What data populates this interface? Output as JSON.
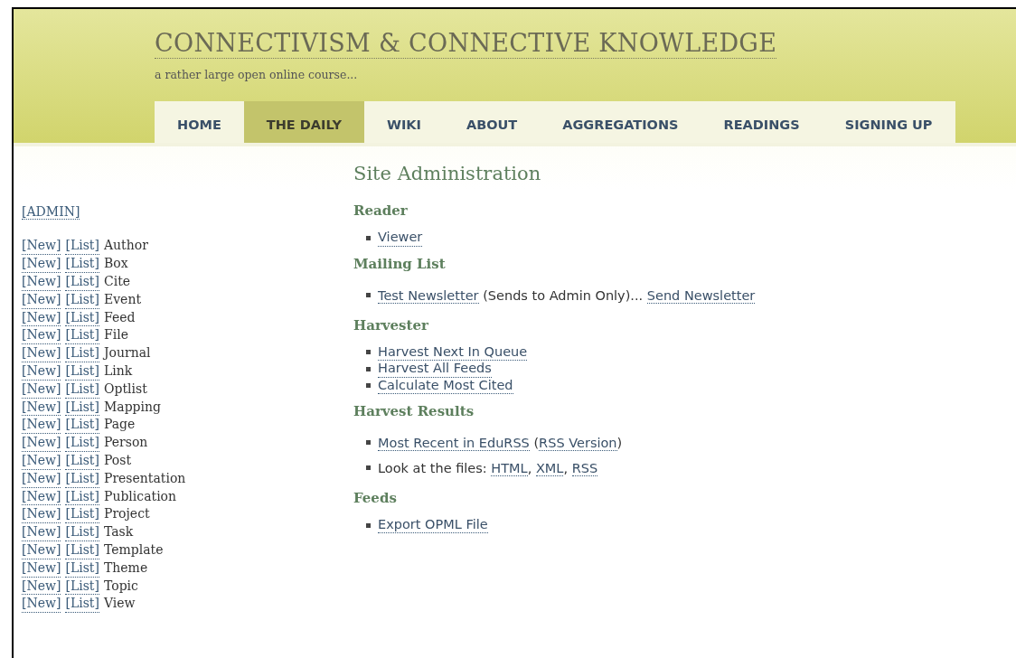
{
  "site": {
    "title": "CONNECTIVISM & CONNECTIVE KNOWLEDGE",
    "tagline": "a rather large open online course..."
  },
  "nav": [
    {
      "label": "HOME",
      "selected": false
    },
    {
      "label": "THE DAILY",
      "selected": true
    },
    {
      "label": "WIKI",
      "selected": false
    },
    {
      "label": "ABOUT",
      "selected": false
    },
    {
      "label": "AGGREGATIONS",
      "selected": false
    },
    {
      "label": "READINGS",
      "selected": false
    },
    {
      "label": "SIGNING UP",
      "selected": false
    }
  ],
  "sidebar": {
    "admin_link": "[ADMIN]",
    "rows": [
      {
        "new": "[New]",
        "list": "[List]",
        "label": "Author"
      },
      {
        "new": "[New]",
        "list": "[List]",
        "label": "Box"
      },
      {
        "new": "[New]",
        "list": "[List]",
        "label": "Cite"
      },
      {
        "new": "[New]",
        "list": "[List]",
        "label": "Event"
      },
      {
        "new": "[New]",
        "list": "[List]",
        "label": "Feed"
      },
      {
        "new": "[New]",
        "list": "[List]",
        "label": "File"
      },
      {
        "new": "[New]",
        "list": "[List]",
        "label": "Journal"
      },
      {
        "new": "[New]",
        "list": "[List]",
        "label": "Link"
      },
      {
        "new": "[New]",
        "list": "[List]",
        "label": "Optlist"
      },
      {
        "new": "[New]",
        "list": "[List]",
        "label": "Mapping"
      },
      {
        "new": "[New]",
        "list": "[List]",
        "label": "Page"
      },
      {
        "new": "[New]",
        "list": "[List]",
        "label": "Person"
      },
      {
        "new": "[New]",
        "list": "[List]",
        "label": "Post"
      },
      {
        "new": "[New]",
        "list": "[List]",
        "label": "Presentation"
      },
      {
        "new": "[New]",
        "list": "[List]",
        "label": "Publication"
      },
      {
        "new": "[New]",
        "list": "[List]",
        "label": "Project"
      },
      {
        "new": "[New]",
        "list": "[List]",
        "label": "Task"
      },
      {
        "new": "[New]",
        "list": "[List]",
        "label": "Template"
      },
      {
        "new": "[New]",
        "list": "[List]",
        "label": "Theme"
      },
      {
        "new": "[New]",
        "list": "[List]",
        "label": "Topic"
      },
      {
        "new": "[New]",
        "list": "[List]",
        "label": "View"
      }
    ]
  },
  "main": {
    "heading": "Site Administration",
    "sections": [
      {
        "title": "Reader",
        "items": [
          [
            {
              "kind": "link",
              "text": "Viewer"
            }
          ]
        ]
      },
      {
        "title": "Mailing List",
        "items": [
          [
            {
              "kind": "link",
              "text": "Test Newsletter"
            },
            {
              "kind": "text",
              "text": " (Sends to Admin Only)... "
            },
            {
              "kind": "link",
              "text": "Send Newsletter"
            }
          ]
        ]
      },
      {
        "title": "Harvester",
        "items": [
          [
            {
              "kind": "link",
              "text": "Harvest Next In Queue"
            }
          ],
          [
            {
              "kind": "link",
              "text": "Harvest All Feeds"
            }
          ],
          [
            {
              "kind": "link",
              "text": "Calculate Most Cited"
            }
          ]
        ]
      },
      {
        "title": "Harvest Results",
        "items": [
          [
            {
              "kind": "link",
              "text": "Most Recent in EduRSS"
            },
            {
              "kind": "text",
              "text": " ("
            },
            {
              "kind": "link",
              "text": "RSS Version"
            },
            {
              "kind": "text",
              "text": ")"
            }
          ],
          [
            {
              "kind": "text",
              "text": "Look at the files: "
            },
            {
              "kind": "link",
              "text": "HTML"
            },
            {
              "kind": "text",
              "text": ", "
            },
            {
              "kind": "link",
              "text": "XML"
            },
            {
              "kind": "text",
              "text": ", "
            },
            {
              "kind": "link",
              "text": "RSS"
            }
          ]
        ]
      },
      {
        "title": "Feeds",
        "items": [
          [
            {
              "kind": "link",
              "text": "Export OPML File"
            }
          ]
        ]
      }
    ]
  }
}
